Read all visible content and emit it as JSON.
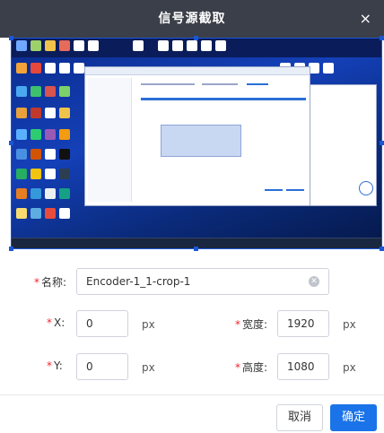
{
  "dialog": {
    "title": "信号源截取",
    "close_icon": "×"
  },
  "form": {
    "name_label": "名称:",
    "name_value": "Encoder-1_1-crop-1",
    "x_label": "X:",
    "x_value": "0",
    "y_label": "Y:",
    "y_value": "0",
    "width_label": "宽度:",
    "width_value": "1920",
    "height_label": "高度:",
    "height_value": "1080",
    "unit": "px",
    "required_mark": "*"
  },
  "buttons": {
    "cancel": "取消",
    "confirm": "确定"
  },
  "colors": {
    "titlebar": "#3b3f49",
    "accent": "#1a73e8",
    "required": "#f5222d",
    "desktop": "#1440b8"
  }
}
